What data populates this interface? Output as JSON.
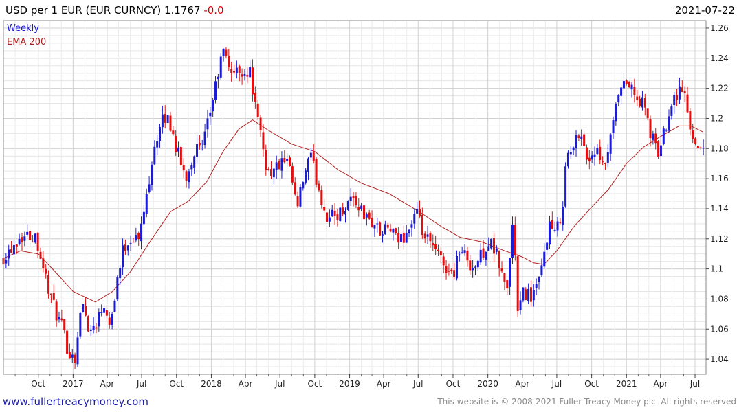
{
  "header": {
    "title": "USD per 1 EUR (EUR CURNCY) 1.1767",
    "change": "-0.0",
    "date": "2021-07-22"
  },
  "footer": {
    "url": "www.fullertreacymoney.com",
    "copyright": "This website is © 2008-2021 Fuller Treacy Money plc. All rights reserved"
  },
  "colors": {
    "up": "#1b1bd6",
    "down": "#e01010",
    "ema": "#b02020",
    "grid": "#d9d9d9"
  },
  "chart_data": {
    "type": "candlestick",
    "legend": [
      {
        "label": "Weekly",
        "color": "#1b1bd6"
      },
      {
        "label": "EMA 200",
        "color": "#b02020"
      }
    ],
    "ylim": [
      1.03,
      1.265
    ],
    "yticks": [
      1.04,
      1.06,
      1.08,
      1.1,
      1.12,
      1.14,
      1.16,
      1.18,
      1.2,
      1.22,
      1.24,
      1.26
    ],
    "ytick_labels": [
      "1.04",
      "1.06",
      "1.08",
      "1.1",
      "1.12",
      "1.14",
      "1.16",
      "1.18",
      "1.2",
      "1.22",
      "1.24",
      "1.26"
    ],
    "xlim": [
      "2016-07-01",
      "2021-07-30"
    ],
    "xticks": [
      {
        "date": "2016-10-01",
        "label": "Oct"
      },
      {
        "date": "2017-01-01",
        "label": "2017"
      },
      {
        "date": "2017-04-01",
        "label": "Apr"
      },
      {
        "date": "2017-07-01",
        "label": "Jul"
      },
      {
        "date": "2017-10-01",
        "label": "Oct"
      },
      {
        "date": "2018-01-01",
        "label": "2018"
      },
      {
        "date": "2018-04-01",
        "label": "Apr"
      },
      {
        "date": "2018-07-01",
        "label": "Jul"
      },
      {
        "date": "2018-10-01",
        "label": "Oct"
      },
      {
        "date": "2019-01-01",
        "label": "2019"
      },
      {
        "date": "2019-04-01",
        "label": "Apr"
      },
      {
        "date": "2019-07-01",
        "label": "Jul"
      },
      {
        "date": "2019-10-01",
        "label": "Oct"
      },
      {
        "date": "2020-01-01",
        "label": "2020"
      },
      {
        "date": "2020-04-01",
        "label": "Apr"
      },
      {
        "date": "2020-07-01",
        "label": "Jul"
      },
      {
        "date": "2020-10-01",
        "label": "Oct"
      },
      {
        "date": "2021-01-01",
        "label": "2021"
      },
      {
        "date": "2021-04-01",
        "label": "Apr"
      },
      {
        "date": "2021-07-01",
        "label": "Jul"
      }
    ],
    "close_anchors": [
      [
        "2016-07-01",
        1.108
      ],
      [
        "2016-08-15",
        1.122
      ],
      [
        "2016-09-25",
        1.122
      ],
      [
        "2016-10-20",
        1.095
      ],
      [
        "2016-11-10",
        1.075
      ],
      [
        "2016-12-01",
        1.062
      ],
      [
        "2016-12-20",
        1.045
      ],
      [
        "2017-01-05",
        1.04
      ],
      [
        "2017-01-25",
        1.078
      ],
      [
        "2017-02-15",
        1.058
      ],
      [
        "2017-03-05",
        1.066
      ],
      [
        "2017-03-25",
        1.078
      ],
      [
        "2017-04-10",
        1.063
      ],
      [
        "2017-04-25",
        1.09
      ],
      [
        "2017-05-15",
        1.115
      ],
      [
        "2017-06-05",
        1.121
      ],
      [
        "2017-06-25",
        1.12
      ],
      [
        "2017-07-15",
        1.15
      ],
      [
        "2017-08-01",
        1.18
      ],
      [
        "2017-08-28",
        1.2
      ],
      [
        "2017-09-10",
        1.2
      ],
      [
        "2017-10-01",
        1.18
      ],
      [
        "2017-10-25",
        1.16
      ],
      [
        "2017-11-20",
        1.18
      ],
      [
        "2017-12-10",
        1.18
      ],
      [
        "2017-12-25",
        1.2
      ],
      [
        "2018-01-15",
        1.225
      ],
      [
        "2018-02-01",
        1.245
      ],
      [
        "2018-02-15",
        1.235
      ],
      [
        "2018-03-05",
        1.23
      ],
      [
        "2018-03-25",
        1.232
      ],
      [
        "2018-04-15",
        1.23
      ],
      [
        "2018-05-01",
        1.2
      ],
      [
        "2018-05-15",
        1.185
      ],
      [
        "2018-05-28",
        1.165
      ],
      [
        "2018-06-15",
        1.165
      ],
      [
        "2018-07-01",
        1.17
      ],
      [
        "2018-07-20",
        1.17
      ],
      [
        "2018-08-05",
        1.155
      ],
      [
        "2018-08-15",
        1.138
      ],
      [
        "2018-09-01",
        1.16
      ],
      [
        "2018-09-20",
        1.175
      ],
      [
        "2018-10-10",
        1.155
      ],
      [
        "2018-10-31",
        1.135
      ],
      [
        "2018-11-20",
        1.135
      ],
      [
        "2018-12-10",
        1.138
      ],
      [
        "2019-01-05",
        1.148
      ],
      [
        "2019-01-25",
        1.142
      ],
      [
        "2019-02-15",
        1.133
      ],
      [
        "2019-03-10",
        1.13
      ],
      [
        "2019-03-25",
        1.122
      ],
      [
        "2019-04-15",
        1.128
      ],
      [
        "2019-05-05",
        1.118
      ],
      [
        "2019-05-25",
        1.122
      ],
      [
        "2019-06-10",
        1.128
      ],
      [
        "2019-06-25",
        1.138
      ],
      [
        "2019-07-15",
        1.122
      ],
      [
        "2019-08-05",
        1.115
      ],
      [
        "2019-08-25",
        1.108
      ],
      [
        "2019-09-10",
        1.102
      ],
      [
        "2019-09-30",
        1.095
      ],
      [
        "2019-10-15",
        1.112
      ],
      [
        "2019-11-05",
        1.108
      ],
      [
        "2019-11-25",
        1.1
      ],
      [
        "2019-12-20",
        1.112
      ],
      [
        "2020-01-05",
        1.118
      ],
      [
        "2020-01-25",
        1.108
      ],
      [
        "2020-02-20",
        1.085
      ],
      [
        "2020-03-09",
        1.135
      ],
      [
        "2020-03-20",
        1.07
      ],
      [
        "2020-04-05",
        1.085
      ],
      [
        "2020-04-25",
        1.082
      ],
      [
        "2020-05-15",
        1.09
      ],
      [
        "2020-05-29",
        1.11
      ],
      [
        "2020-06-10",
        1.13
      ],
      [
        "2020-06-28",
        1.122
      ],
      [
        "2020-07-15",
        1.14
      ],
      [
        "2020-07-27",
        1.175
      ],
      [
        "2020-08-15",
        1.18
      ],
      [
        "2020-09-01",
        1.195
      ],
      [
        "2020-09-20",
        1.17
      ],
      [
        "2020-10-10",
        1.18
      ],
      [
        "2020-11-01",
        1.165
      ],
      [
        "2020-11-20",
        1.185
      ],
      [
        "2020-12-10",
        1.215
      ],
      [
        "2021-01-05",
        1.225
      ],
      [
        "2021-01-25",
        1.212
      ],
      [
        "2021-02-15",
        1.21
      ],
      [
        "2021-03-05",
        1.19
      ],
      [
        "2021-03-25",
        1.177
      ],
      [
        "2021-04-10",
        1.19
      ],
      [
        "2021-04-25",
        1.208
      ],
      [
        "2021-05-15",
        1.218
      ],
      [
        "2021-06-01",
        1.22
      ],
      [
        "2021-06-18",
        1.192
      ],
      [
        "2021-07-05",
        1.185
      ],
      [
        "2021-07-22",
        1.177
      ]
    ],
    "ema_anchors": [
      [
        "2016-07-01",
        1.107
      ],
      [
        "2016-08-15",
        1.112
      ],
      [
        "2016-10-01",
        1.11
      ],
      [
        "2016-11-15",
        1.098
      ],
      [
        "2017-01-01",
        1.085
      ],
      [
        "2017-03-01",
        1.078
      ],
      [
        "2017-04-15",
        1.085
      ],
      [
        "2017-06-01",
        1.098
      ],
      [
        "2017-07-15",
        1.115
      ],
      [
        "2017-09-15",
        1.138
      ],
      [
        "2017-11-01",
        1.145
      ],
      [
        "2017-12-20",
        1.158
      ],
      [
        "2018-02-01",
        1.178
      ],
      [
        "2018-03-15",
        1.193
      ],
      [
        "2018-04-20",
        1.199
      ],
      [
        "2018-06-01",
        1.192
      ],
      [
        "2018-08-01",
        1.183
      ],
      [
        "2018-10-01",
        1.178
      ],
      [
        "2018-12-01",
        1.166
      ],
      [
        "2019-02-01",
        1.157
      ],
      [
        "2019-04-15",
        1.15
      ],
      [
        "2019-06-01",
        1.143
      ],
      [
        "2019-07-10",
        1.137
      ],
      [
        "2019-09-01",
        1.128
      ],
      [
        "2019-10-20",
        1.121
      ],
      [
        "2019-12-15",
        1.118
      ],
      [
        "2020-02-15",
        1.112
      ],
      [
        "2020-04-01",
        1.108
      ],
      [
        "2020-05-01",
        1.104
      ],
      [
        "2020-05-28",
        1.103
      ],
      [
        "2020-07-01",
        1.112
      ],
      [
        "2020-08-15",
        1.128
      ],
      [
        "2020-10-01",
        1.141
      ],
      [
        "2020-11-15",
        1.153
      ],
      [
        "2021-01-01",
        1.17
      ],
      [
        "2021-02-15",
        1.181
      ],
      [
        "2021-04-01",
        1.188
      ],
      [
        "2021-05-20",
        1.195
      ],
      [
        "2021-06-20",
        1.195
      ],
      [
        "2021-07-22",
        1.191
      ]
    ]
  }
}
